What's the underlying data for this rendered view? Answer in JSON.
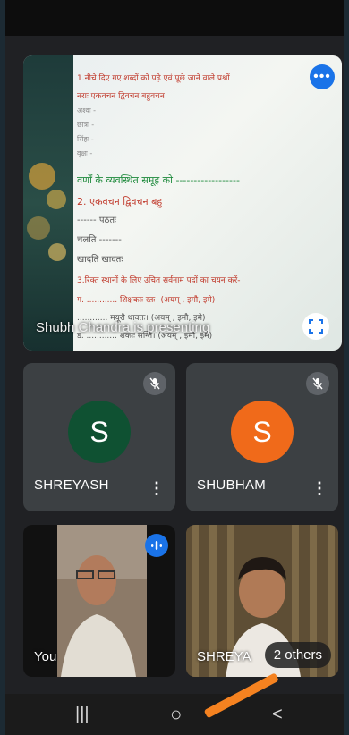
{
  "presentation": {
    "presenter_label": "Shubh Chandra is presenting",
    "slide_lines": [
      {
        "text": "1.नीचे दिए गए शब्दों को पढ़े एवं पूछे जाने वाले प्रश्नों",
        "color": "#c0392b",
        "size": 9
      },
      {
        "text": "नराः     एकवचन        द्विवचन       बहुवचन",
        "color": "#c0392b",
        "size": 9
      },
      {
        "text": "अश्वः -",
        "color": "#888888",
        "size": 8
      },
      {
        "text": "छात्रः -",
        "color": "#888888",
        "size": 8
      },
      {
        "text": "सिंहः -",
        "color": "#888888",
        "size": 8
      },
      {
        "text": "वृक्षः -",
        "color": "#888888",
        "size": 8
      },
      {
        "text": "वर्णों के व्यवस्थित समूह को ------------------",
        "color": "#1e8a3c",
        "size": 11
      },
      {
        "text": "2.  एकवचन              द्विवचन          बहु",
        "color": "#c0392b",
        "size": 11
      },
      {
        "text": "    ------                       पठतः",
        "color": "#555555",
        "size": 10
      },
      {
        "text": "  चलति                         -------",
        "color": "#555555",
        "size": 10
      },
      {
        "text": "  खादति                        खादतः",
        "color": "#555555",
        "size": 10
      },
      {
        "text": "3.रिक्त स्थानों के लिए उचित सर्वनाम पदों का चयन करें-",
        "color": "#c0392b",
        "size": 9
      },
      {
        "text": "ग.  ............ शिक्षकाः स्तः। (अयम् , इमौ, इमे)",
        "color": "#c0392b",
        "size": 9
      },
      {
        "text": "        ............ मयूरौ धावतः। (अयम् , इमौ, इमे)",
        "color": "#555555",
        "size": 9
      },
      {
        "text": "  ड.  ............ शकाः सन्ति। (अयम् , इमौ, इमे)",
        "color": "#555555",
        "size": 9
      }
    ]
  },
  "participants": [
    {
      "name": "SHREYASH",
      "initial": "S",
      "avatar_color": "#0f5132",
      "muted": true
    },
    {
      "name": "SHUBHAM",
      "initial": "S",
      "avatar_color": "#f06a1a",
      "muted": true
    }
  ],
  "video_tiles": [
    {
      "label": "You",
      "speaking": true
    },
    {
      "label": "SHREYA",
      "others_label": "2 others"
    }
  ],
  "navbar": {
    "recent": "|||",
    "home": "○",
    "back": "<"
  },
  "icons": {
    "mic_off": "mic-off-icon",
    "more": "more-options-icon",
    "expand": "expand-icon",
    "kebab": "kebab-menu-icon",
    "speaking": "speaking-indicator-icon"
  },
  "colors": {
    "accent": "#1a73e8",
    "tile": "#3c4043",
    "background": "#202124"
  }
}
